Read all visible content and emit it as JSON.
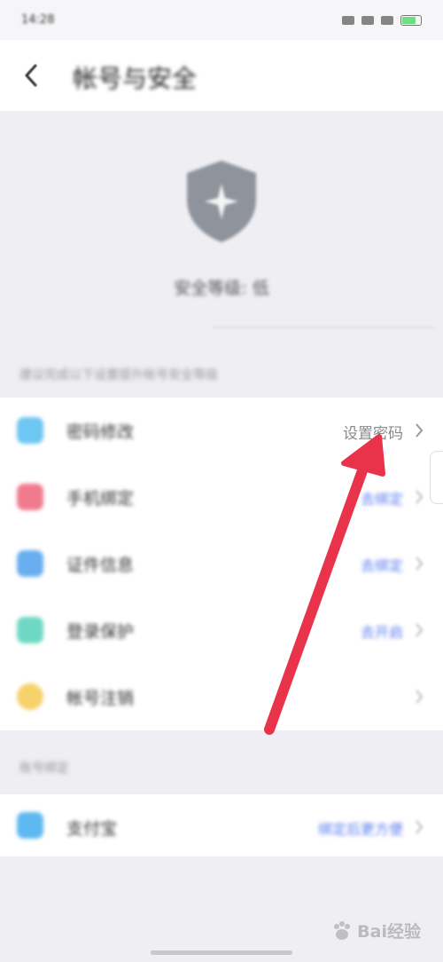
{
  "status_bar": {
    "time": "14:28"
  },
  "header": {
    "title": "帐号与安全"
  },
  "hero": {
    "security_level": "安全等级: 低"
  },
  "section_hint": "建议完成以下设置提升帐号安全等级",
  "security_items": [
    {
      "label": "密码修改",
      "status": "设置密码",
      "icon": "lock-icon",
      "icon_color": "#6ec6f2"
    },
    {
      "label": "手机绑定",
      "status": "去绑定",
      "icon": "phone-icon",
      "icon_color": "#f07b8e"
    },
    {
      "label": "证件信息",
      "status": "去绑定",
      "icon": "id-card-icon",
      "icon_color": "#6aaef0"
    },
    {
      "label": "登录保护",
      "status": "去开启",
      "icon": "shield-check-icon",
      "icon_color": "#6fd8c4"
    },
    {
      "label": "帐号注销",
      "status": "",
      "icon": "cancel-account-icon",
      "icon_color": "#f6d26a"
    }
  ],
  "third_party_hint": "账号绑定",
  "third_party_items": [
    {
      "label": "支付宝",
      "status": "绑定后更方便",
      "icon": "alipay-icon",
      "icon_color": "#5eb9f0"
    }
  ],
  "watermark": {
    "text": "Bai经验"
  },
  "colors": {
    "arrow": "#e8334a",
    "link": "#5b7cf0"
  }
}
